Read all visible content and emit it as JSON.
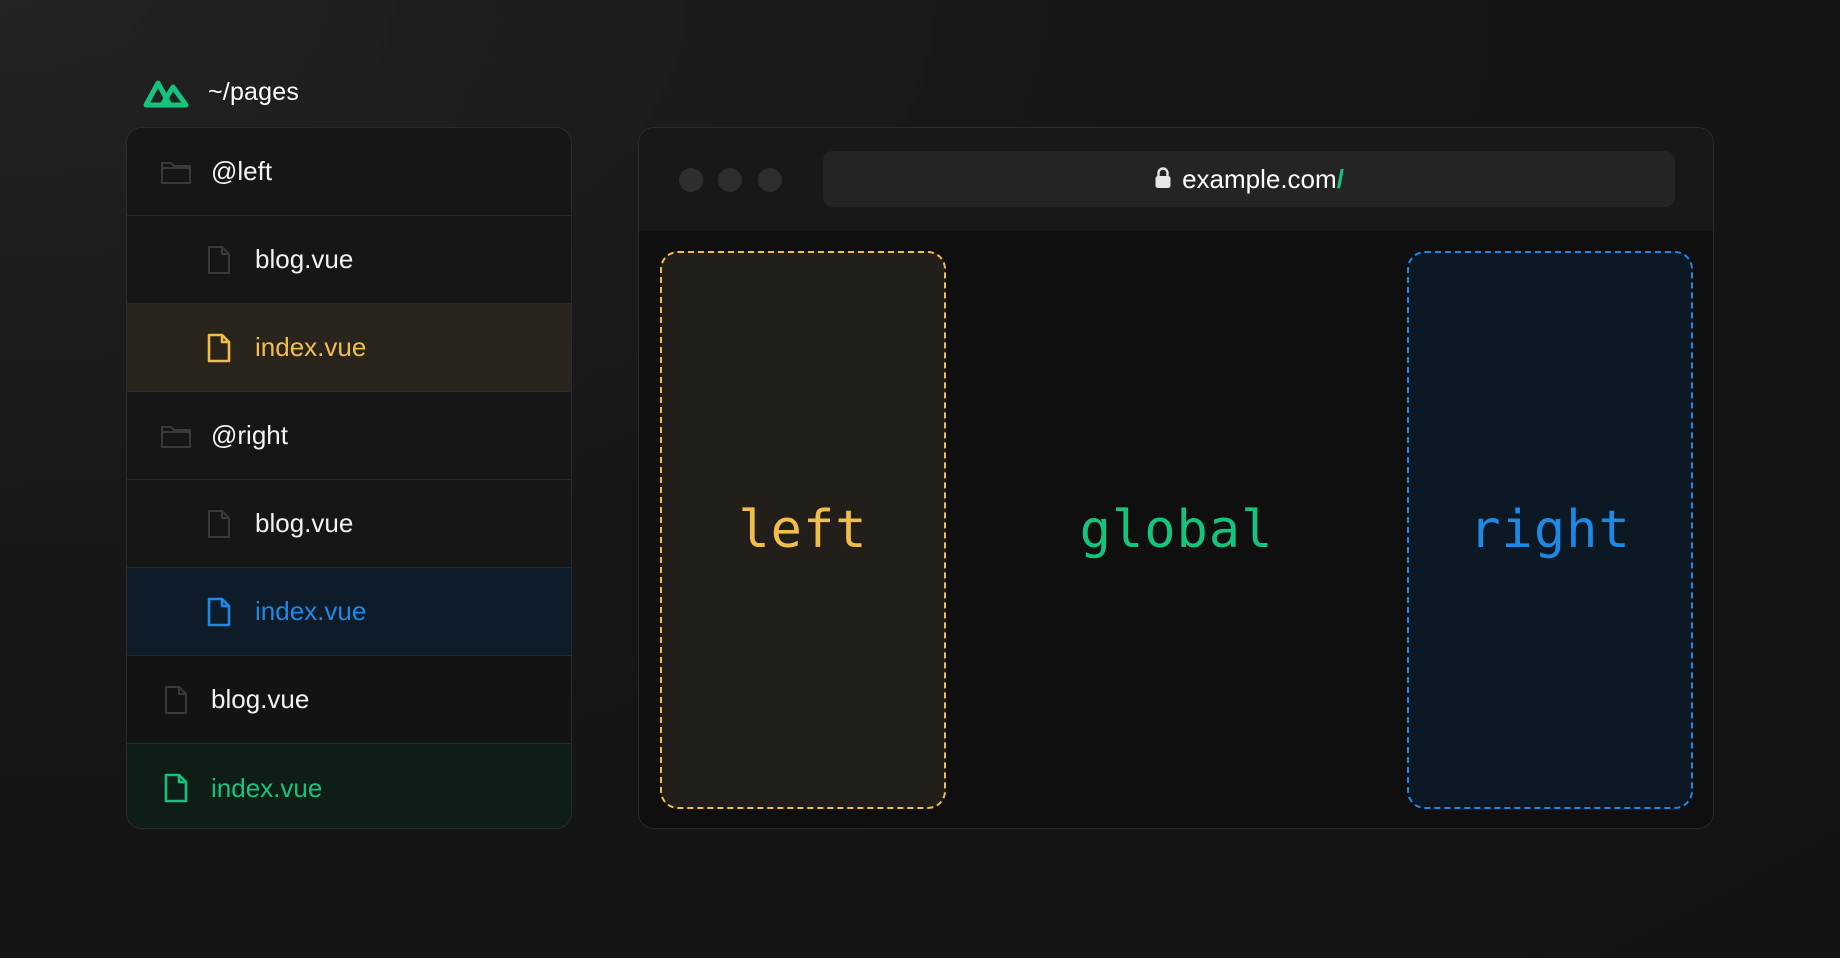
{
  "header": {
    "path": "~/pages",
    "logo_icon": "nuxt-logo-icon"
  },
  "tree": {
    "items": [
      {
        "label": "@left",
        "icon": "folder-icon",
        "depth": 0,
        "state": "group"
      },
      {
        "label": "blog.vue",
        "icon": "file-icon",
        "depth": 1,
        "state": "normal"
      },
      {
        "label": "index.vue",
        "icon": "file-icon",
        "depth": 1,
        "state": "active-yellow"
      },
      {
        "label": "@right",
        "icon": "folder-icon",
        "depth": 0,
        "state": "group"
      },
      {
        "label": "blog.vue",
        "icon": "file-icon",
        "depth": 1,
        "state": "normal"
      },
      {
        "label": "index.vue",
        "icon": "file-icon",
        "depth": 1,
        "state": "active-blue"
      },
      {
        "label": "blog.vue",
        "icon": "file-icon",
        "depth": 0,
        "state": "root"
      },
      {
        "label": "index.vue",
        "icon": "file-icon",
        "depth": 0,
        "state": "active-green"
      }
    ]
  },
  "browser": {
    "url_host": "example.com",
    "url_path": "/",
    "lock_icon": "lock-icon"
  },
  "panels": {
    "left": "left",
    "global": "global",
    "right": "right"
  },
  "colors": {
    "yellow": "#f1be4b",
    "blue": "#1e88e5",
    "green": "#15c47c",
    "muted_icon": "#3a3a3a"
  }
}
